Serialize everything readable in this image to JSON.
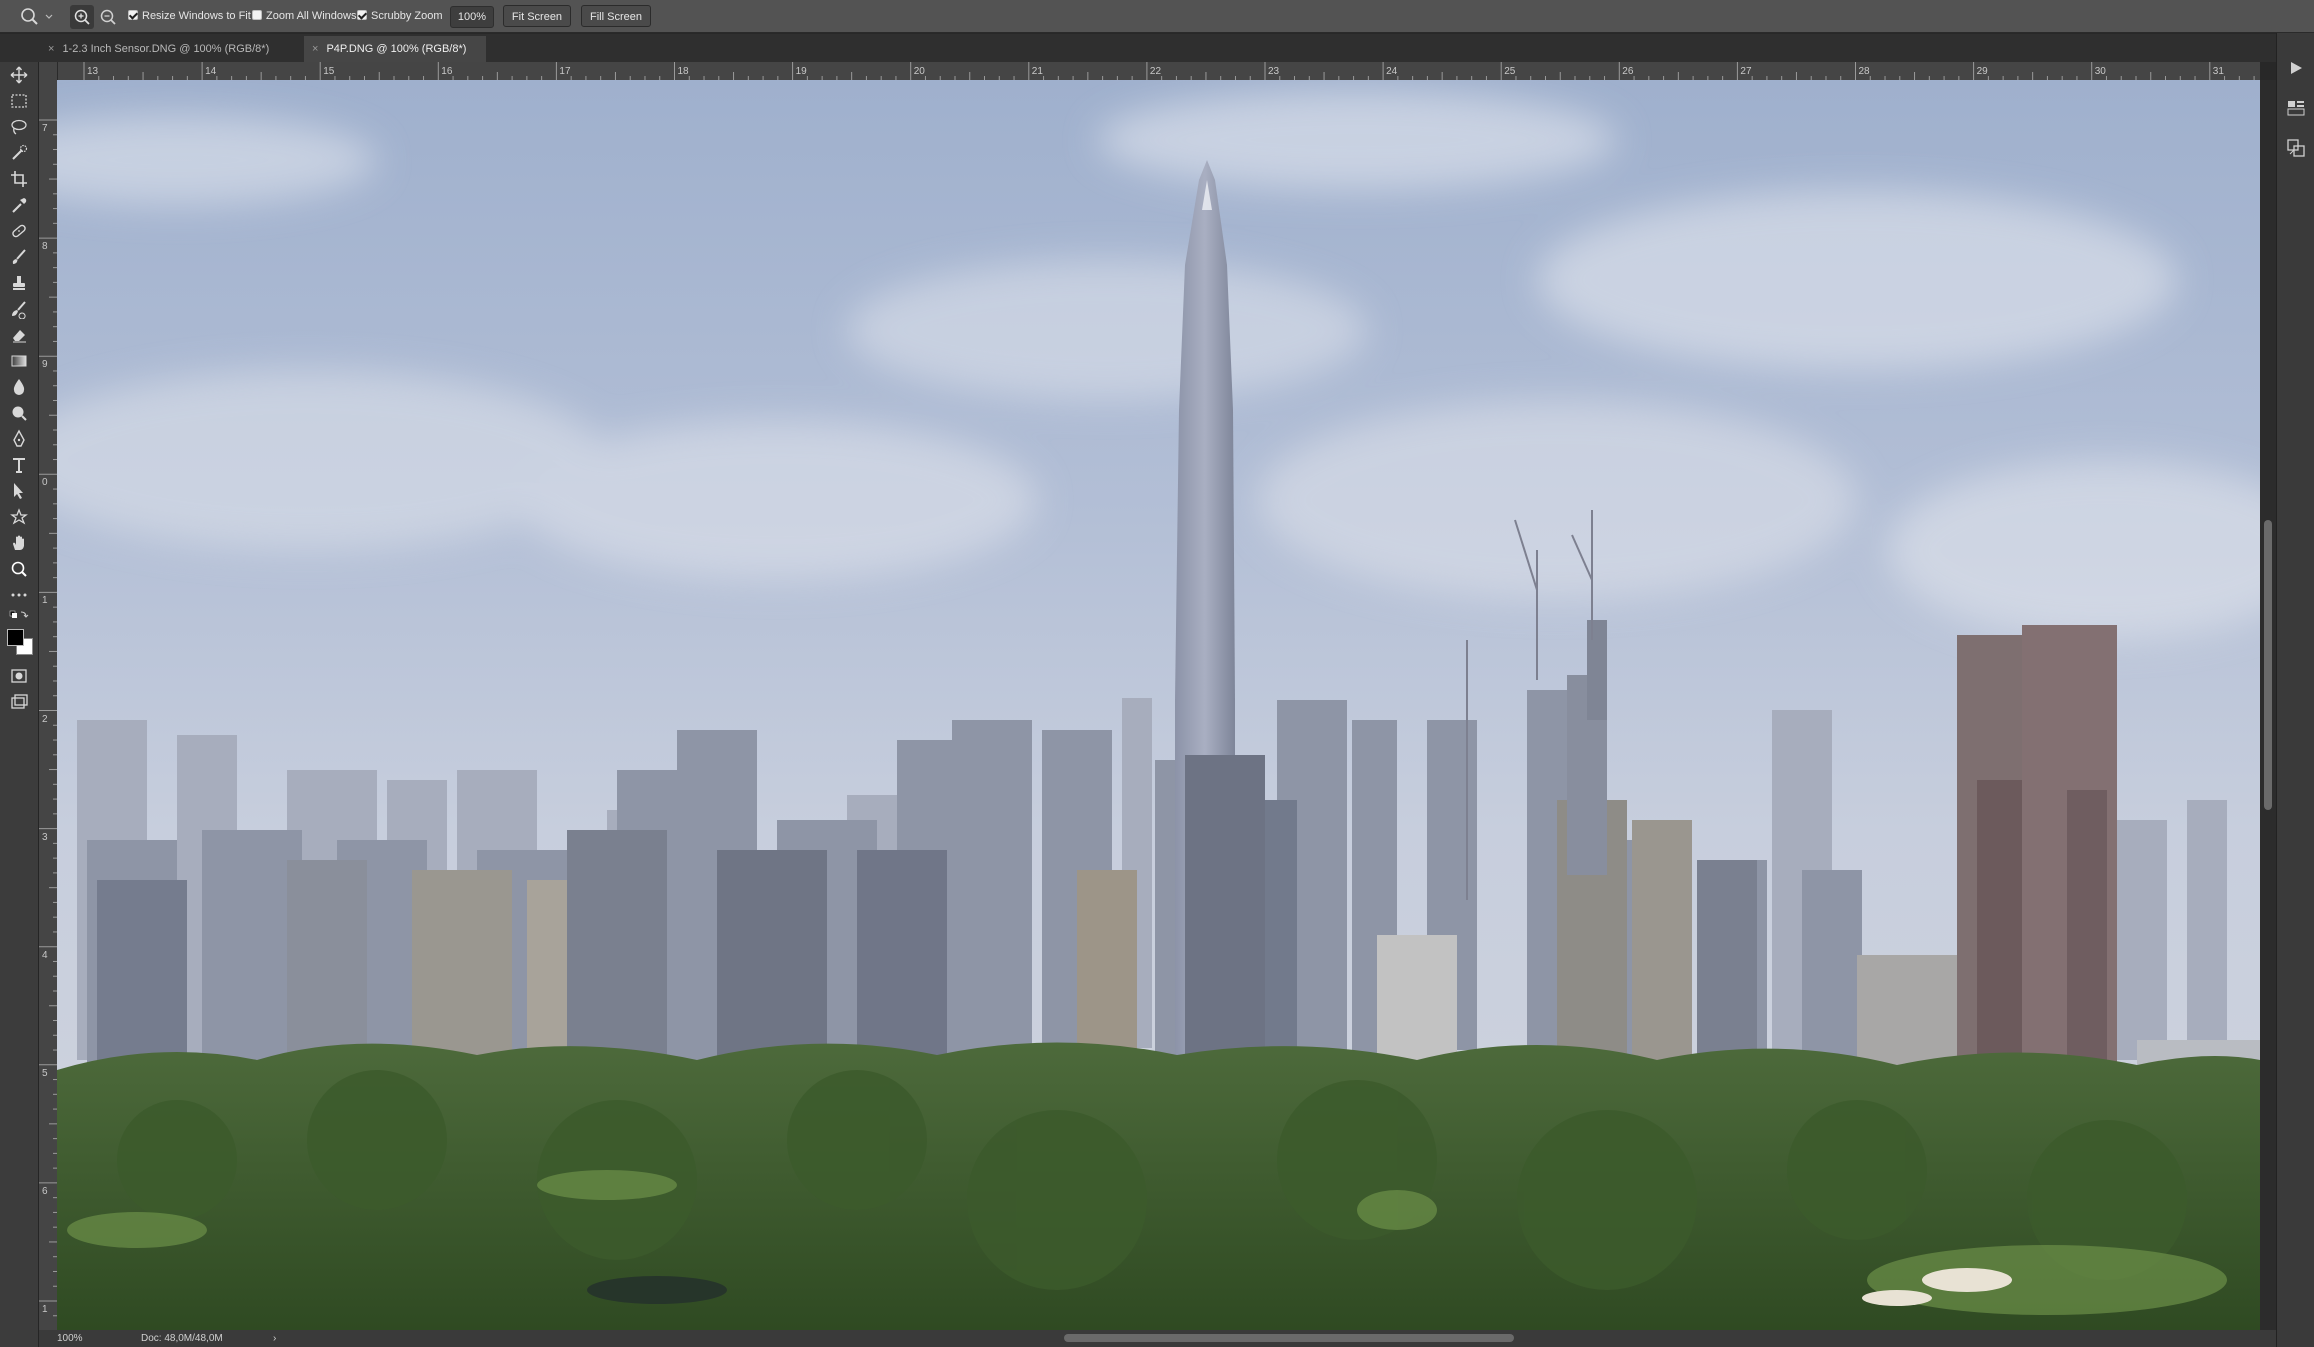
{
  "options_bar": {
    "resize_windows": {
      "label": "Resize Windows to Fit",
      "checked": true
    },
    "zoom_all_windows": {
      "label": "Zoom All Windows",
      "checked": false
    },
    "scrubby_zoom": {
      "label": "Scrubby Zoom",
      "checked": true
    },
    "zoom_value": "100%",
    "fit_screen": "Fit Screen",
    "fill_screen": "Fill Screen"
  },
  "tabs": [
    {
      "label": "1-2.3 Inch Sensor.DNG @ 100% (RGB/8*)",
      "active": false
    },
    {
      "label": "P4P.DNG @ 100% (RGB/8*)",
      "active": true
    }
  ],
  "ruler": {
    "h_labels": [
      "13",
      "14",
      "15",
      "16",
      "17",
      "18",
      "19",
      "20",
      "21",
      "22",
      "23",
      "24",
      "25",
      "26",
      "27",
      "28",
      "29",
      "30",
      "31"
    ],
    "v_labels": [
      "7",
      "8",
      "9",
      "0",
      "1",
      "2",
      "3",
      "4",
      "5",
      "6",
      "1"
    ]
  },
  "status": {
    "zoom": "100%",
    "doc": "Doc: 48,0M/48,0M",
    "arrow": "›"
  },
  "tools": [
    "move-tool-icon",
    "marquee-tool-icon",
    "lasso-tool-icon",
    "quick-select-tool-icon",
    "crop-tool-icon",
    "eyedropper-tool-icon",
    "healing-brush-tool-icon",
    "brush-tool-icon",
    "clone-stamp-tool-icon",
    "history-brush-tool-icon",
    "eraser-tool-icon",
    "gradient-tool-icon",
    "blur-tool-icon",
    "dodge-tool-icon",
    "pen-tool-icon",
    "type-tool-icon",
    "path-select-tool-icon",
    "custom-shape-tool-icon",
    "hand-tool-icon",
    "zoom-tool-icon",
    "more-tools-icon"
  ],
  "colors": {
    "ui_dark": "#282828",
    "panel": "#3c3c3c",
    "optbar": "#535353",
    "sky": "#a8b6cf",
    "trees": "#3f5e2e"
  }
}
